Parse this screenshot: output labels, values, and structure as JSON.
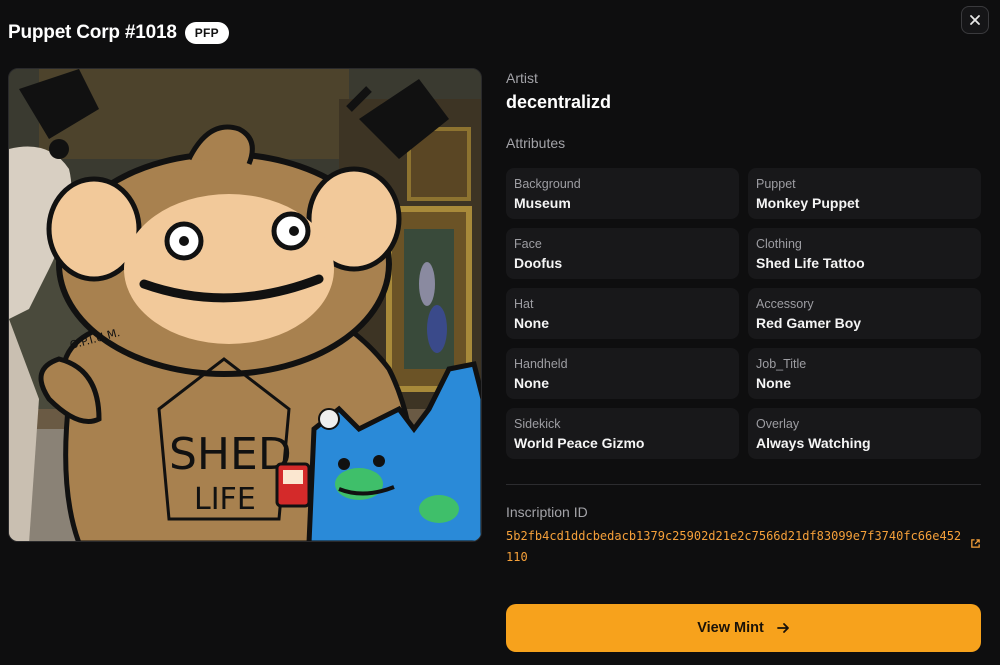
{
  "header": {
    "title": "Puppet Corp #1018",
    "badge": "PFP"
  },
  "close": {
    "icon": "close-icon"
  },
  "artwork": {
    "tattoo_text_1": "SHED",
    "tattoo_text_2": "LIFE",
    "tag_text": "O.P.I.U.M."
  },
  "artist": {
    "label": "Artist",
    "name": "decentralizd"
  },
  "attributes": {
    "title": "Attributes",
    "items": [
      {
        "key": "Background",
        "value": "Museum"
      },
      {
        "key": "Puppet",
        "value": "Monkey Puppet"
      },
      {
        "key": "Face",
        "value": "Doofus"
      },
      {
        "key": "Clothing",
        "value": "Shed Life Tattoo"
      },
      {
        "key": "Hat",
        "value": "None"
      },
      {
        "key": "Accessory",
        "value": "Red Gamer Boy"
      },
      {
        "key": "Handheld",
        "value": "None"
      },
      {
        "key": "Job_Title",
        "value": "None"
      },
      {
        "key": "Sidekick",
        "value": "World Peace Gizmo"
      },
      {
        "key": "Overlay",
        "value": "Always Watching"
      }
    ]
  },
  "inscription": {
    "label": "Inscription ID",
    "id": "5b2fb4cd1ddcbedacb1379c25902d21e2c7566d21df83099e7f3740fc66e452110"
  },
  "cta": {
    "label": "View Mint",
    "icon": "arrow-right-icon"
  },
  "colors": {
    "accent": "#f7a21c",
    "inscription_text": "#f5a03a",
    "background": "#0e0e0f",
    "card": "#18181a"
  }
}
